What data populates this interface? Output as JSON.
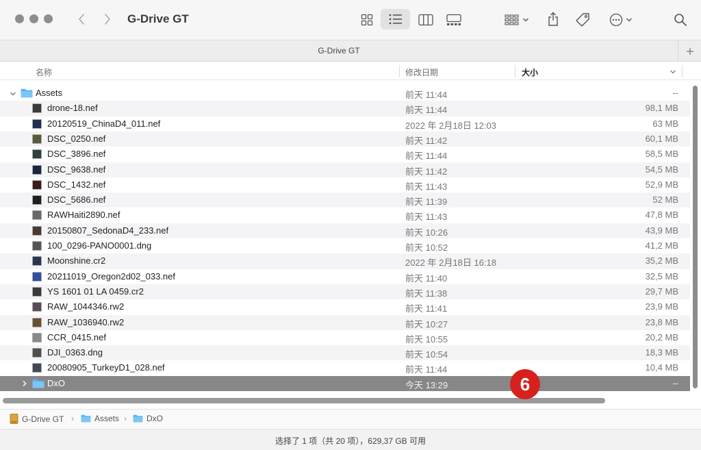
{
  "window": {
    "title": "G-Drive GT"
  },
  "tab": {
    "title": "G-Drive GT"
  },
  "columns": {
    "name": "名称",
    "date": "修改日期",
    "size": "大小"
  },
  "rows": [
    {
      "name": "Assets",
      "date": "前天 11:44",
      "size": "--",
      "kind": "folder",
      "expanded": true
    },
    {
      "name": "drone-18.nef",
      "date": "前天 11:44",
      "size": "98,1 MB",
      "kind": "file",
      "thumb": "#3a3a3a"
    },
    {
      "name": "20120519_ChinaD4_011.nef",
      "date": "2022 年 2月18日 12:03",
      "size": "63 MB",
      "kind": "file",
      "thumb": "#1f2f55"
    },
    {
      "name": "DSC_0250.nef",
      "date": "前天 11:42",
      "size": "60,1 MB",
      "kind": "file",
      "thumb": "#5a5a3a"
    },
    {
      "name": "DSC_3896.nef",
      "date": "前天 11:44",
      "size": "58,5 MB",
      "kind": "file",
      "thumb": "#2f3f3f"
    },
    {
      "name": "DSC_9638.nef",
      "date": "前天 11:42",
      "size": "54,5 MB",
      "kind": "file",
      "thumb": "#1a2540"
    },
    {
      "name": "DSC_1432.nef",
      "date": "前天 11:43",
      "size": "52,9 MB",
      "kind": "file",
      "thumb": "#3a1a1a"
    },
    {
      "name": "DSC_5686.nef",
      "date": "前天 11:39",
      "size": "52 MB",
      "kind": "file",
      "thumb": "#202020"
    },
    {
      "name": "RAWHaiti2890.nef",
      "date": "前天 11:43",
      "size": "47,8 MB",
      "kind": "file",
      "thumb": "#6a6a6a"
    },
    {
      "name": "20150807_SedonaD4_233.nef",
      "date": "前天 10:26",
      "size": "43,9 MB",
      "kind": "file",
      "thumb": "#4a3a30"
    },
    {
      "name": "100_0296-PANO0001.dng",
      "date": "前天 10:52",
      "size": "41,2 MB",
      "kind": "file",
      "thumb": "#555555"
    },
    {
      "name": "Moonshine.cr2",
      "date": "2022 年 2月18日 16:18",
      "size": "35,2 MB",
      "kind": "file",
      "thumb": "#2a3550"
    },
    {
      "name": "20211019_Oregon2d02_033.nef",
      "date": "前天 11:40",
      "size": "32,5 MB",
      "kind": "file",
      "thumb": "#3050a0"
    },
    {
      "name": "YS 1601 01 LA 0459.cr2",
      "date": "前天 11:38",
      "size": "29,7 MB",
      "kind": "file",
      "thumb": "#3a3a3a"
    },
    {
      "name": "RAW_1044346.rw2",
      "date": "前天 11:41",
      "size": "23,9 MB",
      "kind": "file",
      "thumb": "#5a4a5a"
    },
    {
      "name": "RAW_1036940.rw2",
      "date": "前天 10:27",
      "size": "23,8 MB",
      "kind": "file",
      "thumb": "#6a5030"
    },
    {
      "name": "CCR_0415.nef",
      "date": "前天 10:55",
      "size": "20,2 MB",
      "kind": "file",
      "thumb": "#8a8a8a"
    },
    {
      "name": "DJI_0363.dng",
      "date": "前天 10:54",
      "size": "18,3 MB",
      "kind": "file",
      "thumb": "#505050"
    },
    {
      "name": "20080905_TurkeyD1_028.nef",
      "date": "前天 11:44",
      "size": "10,4 MB",
      "kind": "file",
      "thumb": "#404a55"
    },
    {
      "name": "DxO",
      "date": "今天 13:29",
      "size": "--",
      "kind": "folder",
      "expanded": false,
      "selected": true
    }
  ],
  "badge": "6",
  "pathbar": [
    "G-Drive GT",
    "Assets",
    "DxO"
  ],
  "status": "选择了 1 项（共 20 项），629,37 GB 可用",
  "colors": {
    "selection": "#878787",
    "badge": "#d7211c",
    "folder": "#5ab3f0"
  }
}
